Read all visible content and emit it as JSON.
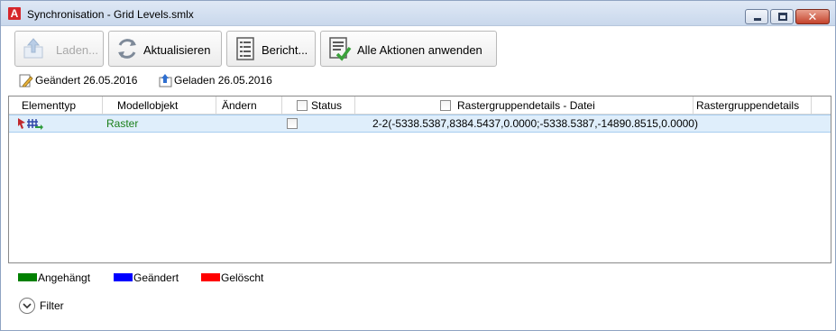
{
  "window": {
    "app_icon_letter": "A",
    "title": "Synchronisation - Grid Levels.smlx",
    "close_glyph": "✕"
  },
  "toolbar": {
    "laden_label": "Laden...",
    "aktualisieren_label": "Aktualisieren",
    "bericht_label": "Bericht...",
    "alle_aktionen_label": "Alle Aktionen anwenden"
  },
  "status": {
    "geaendert": "Geändert 26.05.2016",
    "geladen": "Geladen 26.05.2016"
  },
  "grid": {
    "columns": [
      "Elementtyp",
      "Modellobjekt",
      "Ändern",
      "Status",
      "Rastergruppendetails - Datei",
      "Rastergruppendetails"
    ],
    "rows": [
      {
        "modellobjekt": "Raster",
        "status_checked": false,
        "datei": "2-2(-5338.5387,8384.5437,0.0000;-5338.5387,-14890.8515,0.0000)",
        "details": ""
      }
    ],
    "row_text_color": "#1a7f1a",
    "selected_row_color": "#dfeefb"
  },
  "legend": [
    {
      "label": "Angehängt",
      "color": "#008000"
    },
    {
      "label": "Geändert",
      "color": "#0000ff"
    },
    {
      "label": "Gelöscht",
      "color": "#ff0000"
    }
  ],
  "filter": {
    "label": "Filter"
  }
}
